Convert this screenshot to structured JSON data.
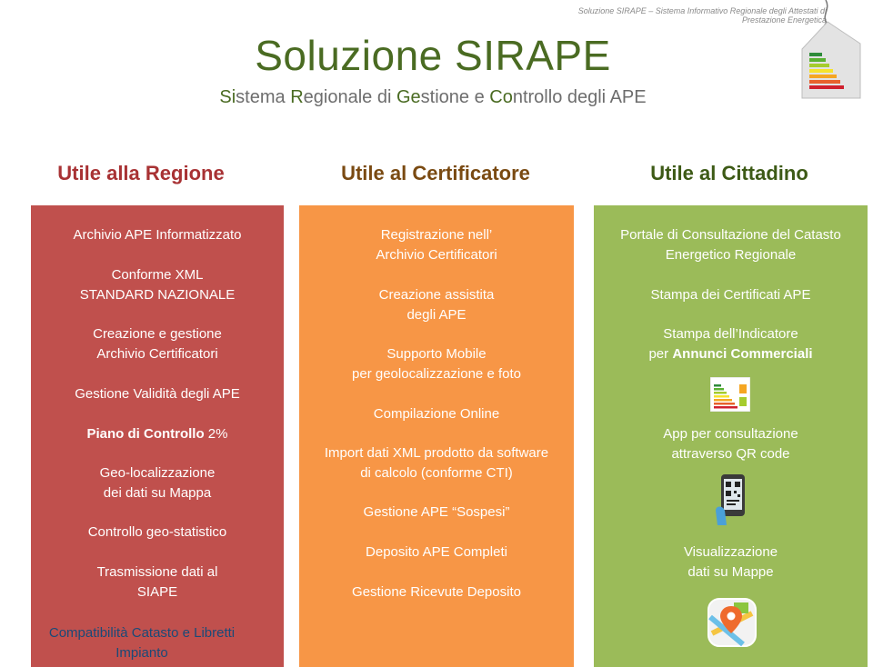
{
  "header": {
    "note_line1": "Soluzione SIRAPE – Sistema Informativo Regionale degli Attestati di",
    "note_line2": "Prestazione Energetica",
    "title": "Soluzione SIRAPE",
    "subtitle_parts": [
      "Si",
      "stema ",
      "R",
      "egionale di ",
      "Ge",
      "stione e ",
      "Co",
      "ntrollo degli APE"
    ]
  },
  "columns": {
    "regione": {
      "heading": "Utile alla Regione",
      "items": [
        {
          "line1": "Archivio APE Informatizzato"
        },
        {
          "line1": "Conforme XML",
          "line2": "STANDARD NAZIONALE"
        },
        {
          "line1": "Creazione e gestione",
          "line2": "Archivio Certificatori"
        },
        {
          "line1": "Gestione Validità degli APE"
        },
        {
          "line1_bold": "Piano di Controllo",
          "line1_rest": " 2%"
        },
        {
          "line1": "Geo-localizzazione",
          "line2": "dei dati su Mappa"
        },
        {
          "line1": "Controllo geo-statistico"
        },
        {
          "line1": "Trasmissione dati al",
          "line2": "SIAPE"
        }
      ],
      "footer_line1": "Compatibilità Catasto e Libretti",
      "footer_line2": "Impianto"
    },
    "certificatore": {
      "heading": "Utile al Certificatore",
      "items": [
        {
          "line1": "Registrazione nell’",
          "line2": "Archivio Certificatori"
        },
        {
          "line1": "Creazione assistita",
          "line2": "degli APE"
        },
        {
          "line1": "Supporto Mobile",
          "line2": "per geolocalizzazione e foto"
        },
        {
          "line1": "Compilazione Online"
        },
        {
          "line1": "Import dati XML prodotto da software",
          "line2": "di calcolo (conforme CTI)"
        },
        {
          "line1": "Gestione APE “Sospesi”"
        },
        {
          "line1": "Deposito APE Completi"
        },
        {
          "line1": "Gestione Ricevute Deposito"
        }
      ]
    },
    "cittadino": {
      "heading": "Utile al Cittadino",
      "items": [
        {
          "line1": "Portale di Consultazione del Catasto",
          "line2": "Energetico Regionale"
        },
        {
          "line1": "Stampa dei Certificati APE"
        },
        {
          "line1": "Stampa dell’Indicatore",
          "line2_pre": "per ",
          "line2_bold": "Annunci Commerciali"
        },
        {
          "line1": "App per consultazione",
          "line2": "attraverso QR code"
        },
        {
          "line1": "Visualizzazione",
          "line2": "dati su Mappe"
        }
      ],
      "icons": [
        "energy-certificate-icon",
        "qr-phone-icon",
        "map-pin-icon"
      ]
    }
  },
  "colors": {
    "red": "#c0504d",
    "orange": "#f79646",
    "green": "#9bbb59",
    "title_green": "#4a6b22"
  }
}
